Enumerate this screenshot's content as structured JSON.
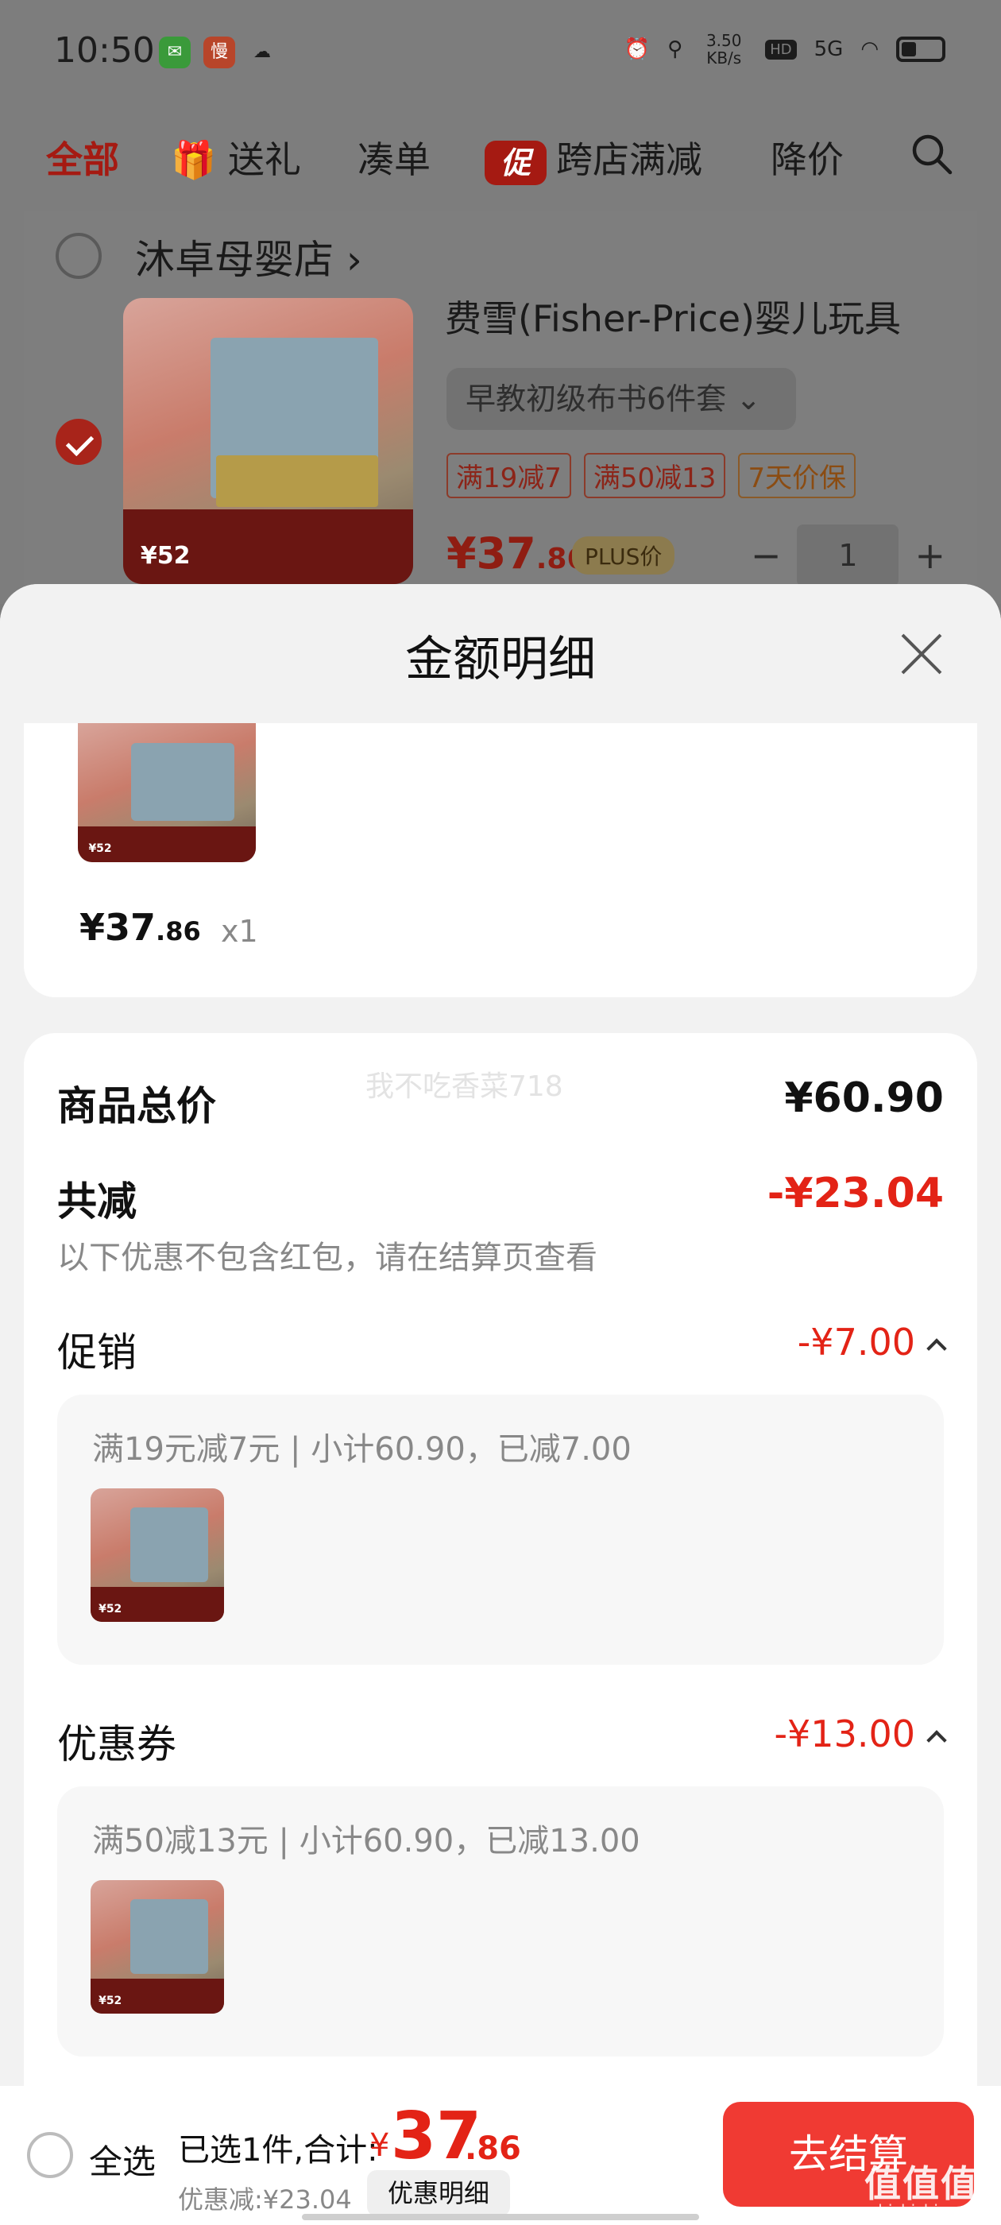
{
  "status_bar": {
    "time": "10:50",
    "app_icons": [
      "wechat-icon",
      "slow-app-icon",
      "chat-icon"
    ],
    "network_speed": "3.50 KB/s",
    "hd_label": "HD",
    "signal_label": "5G"
  },
  "tabs": [
    {
      "label": "全部",
      "active": true
    },
    {
      "label": "送礼",
      "icon": "gift-icon"
    },
    {
      "label": "凑单"
    },
    {
      "label": "跨店满减",
      "badge": "促"
    },
    {
      "label": "降价"
    }
  ],
  "cart": {
    "shop_name": "沐卓母婴店",
    "product_title": "费雪(Fisher-Price)婴儿玩具",
    "sku": "早教初级布书6件套",
    "tags": [
      "满19减7",
      "满50减13",
      "7天价保"
    ],
    "price_int": "¥37",
    "price_dec": ".86",
    "plus_label": "PLUS价",
    "quantity": "1",
    "stepper_minus": "−",
    "stepper_plus": "+",
    "image_text": "¥52"
  },
  "sheet": {
    "title": "金额明细",
    "item_price_int": "¥37",
    "item_price_dec": ".86",
    "item_qty": "x1",
    "watermark": "我不吃香菜718",
    "goods_total_label": "商品总价",
    "goods_total_value": "¥60.90",
    "reduction_label": "共减",
    "reduction_value": "-¥23.04",
    "reduction_note": "以下优惠不包含红包，请在结算页查看",
    "promo_label": "促销",
    "promo_value": "-¥7.00",
    "promo_detail": "满19元减7元 | 小计60.90，已减7.00",
    "coupon_label": "优惠券",
    "coupon_value": "-¥13.00",
    "coupon_detail": "满50减13元 | 小计60.90，已减13.00"
  },
  "bottom_bar": {
    "select_all": "全选",
    "selected_text": "已选1件,合计:",
    "total_symbol": "¥",
    "total_int": "37",
    "total_dec": ".86",
    "discount_text": "优惠减:¥23.04",
    "detail_button": "优惠明细",
    "checkout_button": "去结算",
    "corner_logo": "值值值",
    "corner_sub": "zhizhizhi.com"
  },
  "colors": {
    "accent_red": "#e32316",
    "checkout_red": "#f03a33",
    "dim_overlay": "#7d7d7d"
  }
}
